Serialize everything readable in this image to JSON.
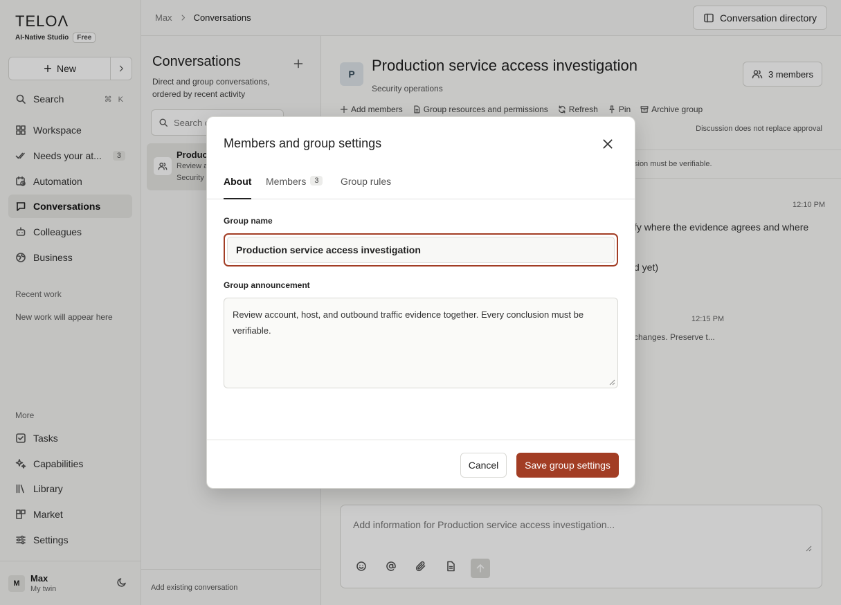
{
  "brand": {
    "logo": "TELOΛ",
    "subtitle": "AI-Native Studio",
    "plan": "Free"
  },
  "sidebar": {
    "new_label": "New",
    "search": {
      "label": "Search",
      "shortcut": "⌘ K"
    },
    "items": [
      {
        "label": "Workspace"
      },
      {
        "label": "Needs your at...",
        "count": "3"
      },
      {
        "label": "Automation"
      },
      {
        "label": "Conversations"
      },
      {
        "label": "Colleagues"
      },
      {
        "label": "Business"
      }
    ],
    "recent_label": "Recent work",
    "recent_empty": "New work will appear here",
    "more_label": "More",
    "more_items": [
      {
        "label": "Tasks"
      },
      {
        "label": "Capabilities"
      },
      {
        "label": "Library"
      },
      {
        "label": "Market"
      },
      {
        "label": "Settings"
      }
    ],
    "user": {
      "initial": "M",
      "name": "Max",
      "subtitle": "My twin"
    }
  },
  "topbar": {
    "breadcrumb": [
      "Max",
      "Conversations"
    ],
    "directory_label": "Conversation directory"
  },
  "convlist": {
    "title": "Conversations",
    "subtitle": "Direct and group conversations, ordered by recent activity",
    "search_placeholder": "Search c",
    "item": {
      "title": "Product",
      "preview": "Review a",
      "subtitle": "Security"
    },
    "footer": "Add existing conversation"
  },
  "main": {
    "avatar_initial": "P",
    "title": "Production service access investigation",
    "subtitle": "Security operations",
    "members_label": "3 members",
    "actions": [
      "Add members",
      "Group resources and permissions",
      "Refresh",
      "Pin",
      "Archive group"
    ],
    "discussion_note": "Discussion does not replace approval",
    "announcement_tail": "sion must be verifiable.",
    "messages": [
      {
        "time": "12:10 PM",
        "text": "fy where the evidence agrees and where",
        "text2": "d yet)"
      },
      {
        "time": "12:15 PM",
        "text": "changes. Preserve t..."
      }
    ],
    "composer_placeholder": "Add information for Production service access investigation..."
  },
  "modal": {
    "title": "Members and group settings",
    "tabs": [
      {
        "label": "About",
        "active": true
      },
      {
        "label": "Members",
        "count": "3"
      },
      {
        "label": "Group rules"
      }
    ],
    "group_name_label": "Group name",
    "group_name_value": "Production service access investigation",
    "announcement_label": "Group announcement",
    "announcement_value": "Review account, host, and outbound traffic evidence together. Every conclusion must be verifiable.",
    "cancel_label": "Cancel",
    "save_label": "Save group settings"
  },
  "colors": {
    "accent": "#a23d24",
    "sidebar_active": "#e6e6e3"
  }
}
